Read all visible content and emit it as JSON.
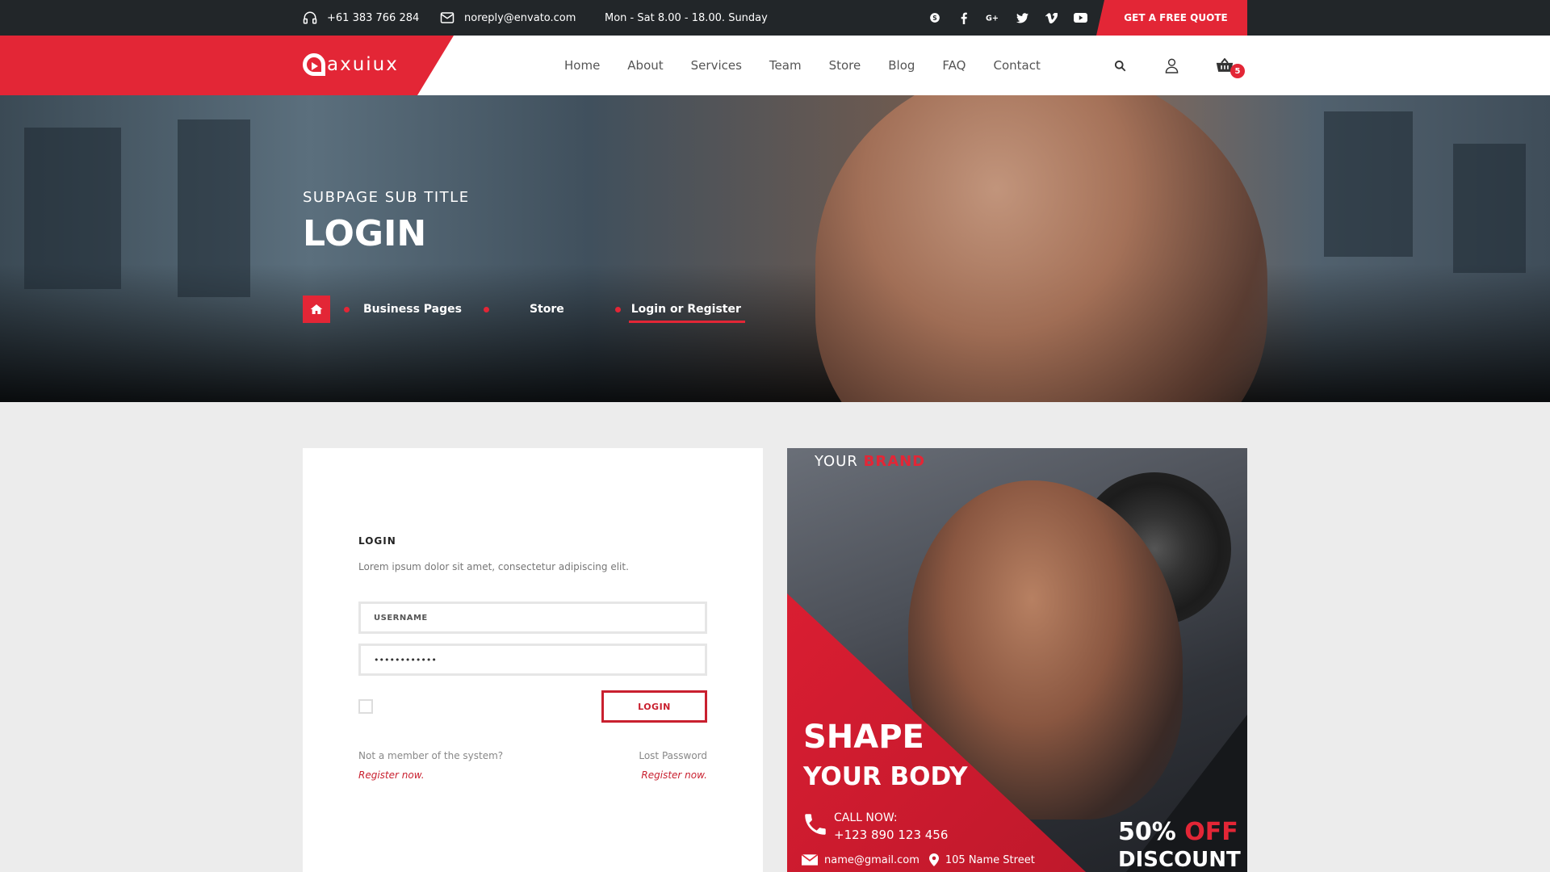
{
  "topbar": {
    "phone": "+61 383 766 284",
    "email": "noreply@envato.com",
    "hours": "Mon - Sat 8.00 - 18.00. Sunday",
    "socials": [
      "skype-icon",
      "facebook-icon",
      "google-plus-icon",
      "twitter-icon",
      "vimeo-icon",
      "youtube-icon"
    ],
    "quote_label": "GET A FREE QUOTE"
  },
  "header": {
    "logo_text": "axuiux",
    "nav": [
      "Home",
      "About",
      "Services",
      "Team",
      "Store",
      "Blog",
      "FAQ",
      "Contact"
    ],
    "cart_count": "5"
  },
  "hero": {
    "subtitle": "SUBPAGE SUB TITLE",
    "title": "LOGIN",
    "breadcrumbs": [
      "Business Pages",
      "Store",
      "Login or Register"
    ]
  },
  "login": {
    "heading": "LOGIN",
    "description": "Lorem ipsum dolor sit amet, consectetur adipiscing elit.",
    "username_placeholder": "USERNAME",
    "password_value": "••••••••••••",
    "button_label": "LOGIN",
    "not_member": "Not a member of the system?",
    "lost_password": "Lost Password",
    "register_left": "Register now.",
    "register_right": "Register now."
  },
  "promo": {
    "brand_prefix": "YOUR",
    "brand_accent": "BRAND",
    "headline_1": "SHAPE",
    "headline_2": "YOUR BODY",
    "call_label": "CALL NOW:",
    "phone": "+123 890 123 456",
    "email": "name@gmail.com",
    "address": "105 Name Street",
    "discount_value": "50%",
    "discount_accent": "OFF",
    "discount_label": "DISCOUNT"
  },
  "colors": {
    "accent": "#e32636",
    "topbar": "#222629"
  }
}
